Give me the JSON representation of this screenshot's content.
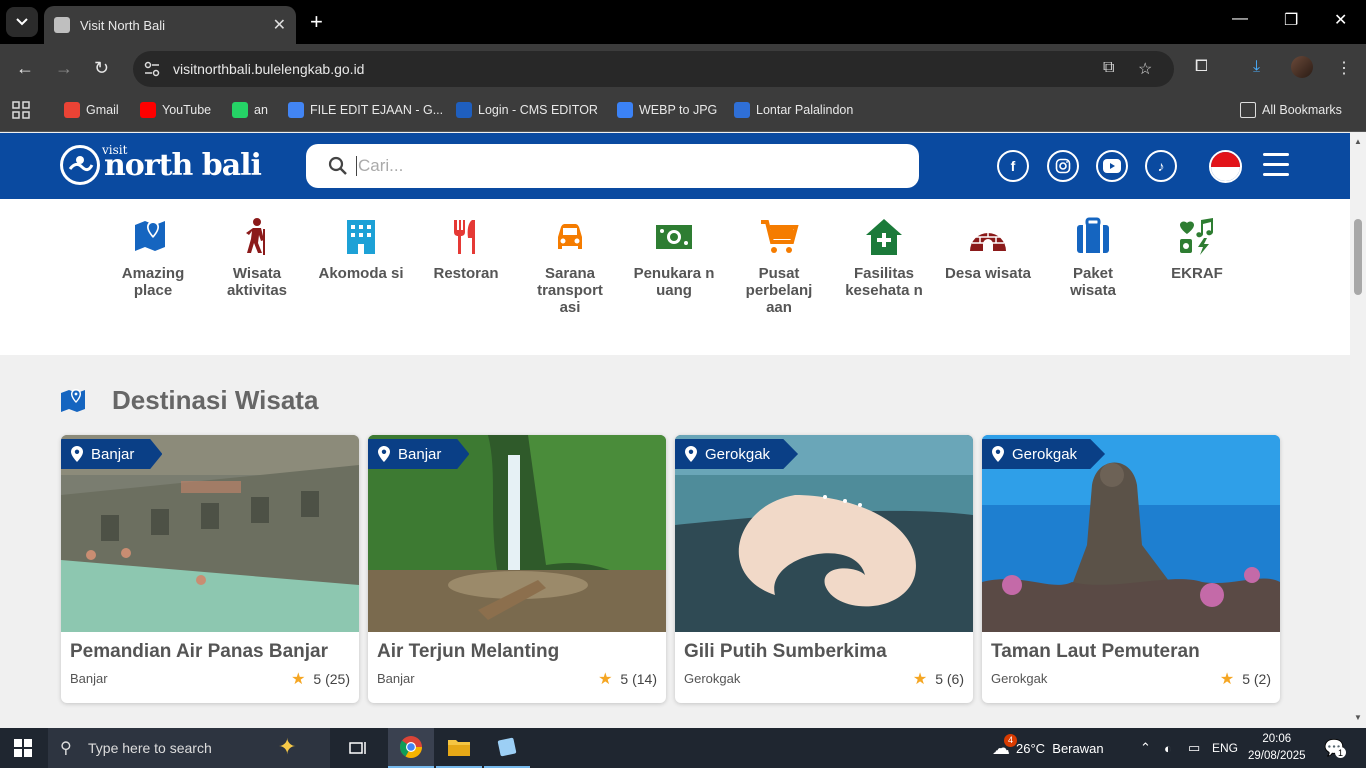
{
  "browser": {
    "tab_title": "Visit North Bali",
    "url": "visitnorthbali.bulelengkab.go.id",
    "bookmarks": [
      {
        "label": "Gmail",
        "icon": "gmail-icon",
        "color": "#ea4335"
      },
      {
        "label": "YouTube",
        "icon": "youtube-icon",
        "color": "#ff0000"
      },
      {
        "label": "an",
        "icon": "whatsapp-icon",
        "color": "#25d366"
      },
      {
        "label": "FILE EDIT EJAAN - G...",
        "icon": "docs-icon",
        "color": "#4285f4"
      },
      {
        "label": "Login - CMS EDITOR",
        "icon": "cms-icon",
        "color": "#1f5fbf"
      },
      {
        "label": "WEBP to JPG",
        "icon": "webp-icon",
        "color": "#3b82f6"
      },
      {
        "label": "Lontar Palalindon",
        "icon": "lontar-icon",
        "color": "#2f6fd6"
      }
    ],
    "all_bookmarks": "All Bookmarks"
  },
  "site": {
    "logo_text": "north bali",
    "logo_small": "visit",
    "search_placeholder": "Cari...",
    "social": [
      "facebook-icon",
      "instagram-icon",
      "youtube-icon",
      "tiktok-icon"
    ],
    "categories": [
      {
        "label": "Amazing place",
        "icon": "map-icon",
        "color": "#1565c0"
      },
      {
        "label": "Wisata aktivitas",
        "icon": "hiker-icon",
        "color": "#8b1a1a"
      },
      {
        "label": "Akomoda si",
        "icon": "building-icon",
        "color": "#1da1d6"
      },
      {
        "label": "Restoran",
        "icon": "utensils-icon",
        "color": "#e53935"
      },
      {
        "label": "Sarana transport asi",
        "icon": "car-icon",
        "color": "#f57c00"
      },
      {
        "label": "Penukara n uang",
        "icon": "money-icon",
        "color": "#2e7d32"
      },
      {
        "label": "Pusat perbelanj aan",
        "icon": "cart-icon",
        "color": "#f57c00"
      },
      {
        "label": "Fasilitas kesehata n",
        "icon": "clinic-icon",
        "color": "#1b7a3a"
      },
      {
        "label": "Desa wisata",
        "icon": "igloo-icon",
        "color": "#8b1a1a"
      },
      {
        "label": "Paket wisata",
        "icon": "suitcase-icon",
        "color": "#1565c0"
      },
      {
        "label": "EKRAF",
        "icon": "creative-icon",
        "color": "#2e7d32"
      }
    ],
    "section_title": "Destinasi Wisata",
    "destinations": [
      {
        "location": "Banjar",
        "name": "Pemandian Air Panas Banjar",
        "area": "Banjar",
        "rating": "5 (25)",
        "scene": "hotspring"
      },
      {
        "location": "Banjar",
        "name": "Air Terjun Melanting",
        "area": "Banjar",
        "rating": "5 (14)",
        "scene": "waterfall"
      },
      {
        "location": "Gerokgak",
        "name": "Gili Putih Sumberkima",
        "area": "Gerokgak",
        "rating": "5 (6)",
        "scene": "sandbar"
      },
      {
        "location": "Gerokgak",
        "name": "Taman Laut Pemuteran",
        "area": "Gerokgak",
        "rating": "5 (2)",
        "scene": "underwater"
      }
    ]
  },
  "taskbar": {
    "search_placeholder": "Type here to search",
    "weather": "26°C  Berawan",
    "lang": "ENG",
    "time": "20:06",
    "date": "29/08/2025",
    "notif_badge": "1",
    "weather_badge": "4"
  }
}
